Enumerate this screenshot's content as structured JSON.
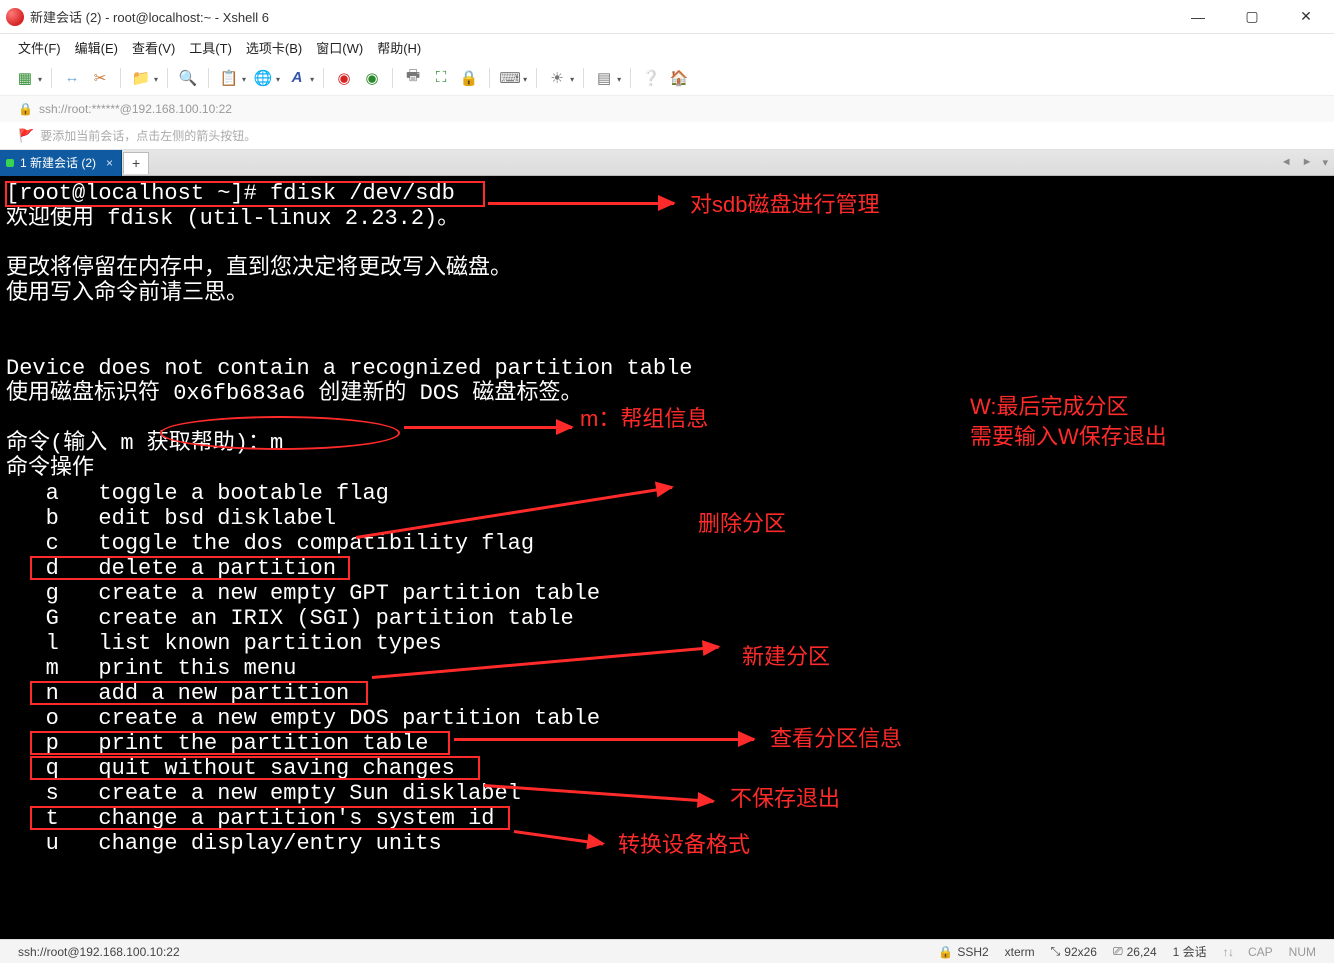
{
  "window": {
    "title": "新建会话 (2) - root@localhost:~ - Xshell 6"
  },
  "menu": {
    "file": "文件(F)",
    "edit": "编辑(E)",
    "view": "查看(V)",
    "tools": "工具(T)",
    "tabs": "选项卡(B)",
    "window": "窗口(W)",
    "help": "帮助(H)"
  },
  "address": {
    "url": "ssh://root:******@192.168.100.10:22"
  },
  "hint": {
    "text": "要添加当前会话，点击左侧的箭头按钮。"
  },
  "tab": {
    "label": "1 新建会话 (2)"
  },
  "term": {
    "line01": "[root@localhost ~]# fdisk /dev/sdb",
    "line02": "欢迎使用 fdisk (util-linux 2.23.2)。",
    "line03": "",
    "line04": "更改将停留在内存中，直到您决定将更改写入磁盘。",
    "line05": "使用写入命令前请三思。",
    "line06": "",
    "line07": "",
    "line08": "Device does not contain a recognized partition table",
    "line09": "使用磁盘标识符 0x6fb683a6 创建新的 DOS 磁盘标签。",
    "line10": "",
    "line11": "命令(输入 m 获取帮助)：m",
    "line12": "命令操作",
    "line13": "   a   toggle a bootable flag",
    "line14": "   b   edit bsd disklabel",
    "line15": "   c   toggle the dos compatibility flag",
    "line16": "   d   delete a partition",
    "line17": "   g   create a new empty GPT partition table",
    "line18": "   G   create an IRIX (SGI) partition table",
    "line19": "   l   list known partition types",
    "line20": "   m   print this menu",
    "line21": "   n   add a new partition",
    "line22": "   o   create a new empty DOS partition table",
    "line23": "   p   print the partition table",
    "line24": "   q   quit without saving changes",
    "line25": "   s   create a new empty Sun disklabel",
    "line26": "   t   change a partition's system id",
    "line27": "   u   change display/entry units"
  },
  "annotations": {
    "a1": "对sdb磁盘进行管理",
    "a2": "m：帮组信息",
    "a3l1": "W:最后完成分区",
    "a3l2": "需要输入W保存退出",
    "a4": "删除分区",
    "a5": "新建分区",
    "a6": "查看分区信息",
    "a7": "不保存退出",
    "a8": "转换设备格式"
  },
  "status": {
    "left": "ssh://root@192.168.100.10:22",
    "proto": "SSH2",
    "termtype": "xterm",
    "size": "92x26",
    "pos": "26,24",
    "sessions": "1 会话",
    "cap": "CAP",
    "num": "NUM"
  }
}
